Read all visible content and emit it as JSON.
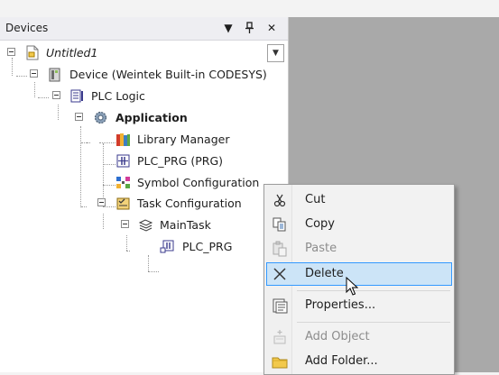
{
  "panel": {
    "title": "Devices",
    "dropdown_glyph": "▼",
    "pin_glyph": "⩚",
    "close_glyph": "✕",
    "combo_glyph": "▼"
  },
  "tree": {
    "project": "Untitled1",
    "device": "Device (Weintek Built-in CODESYS)",
    "plc_logic": "PLC Logic",
    "application": "Application",
    "library_manager": "Library Manager",
    "plc_prg": "PLC_PRG (PRG)",
    "symbol_config": "Symbol Configuration",
    "task_config": "Task Configuration",
    "main_task": "MainTask",
    "task_plc_prg": "PLC_PRG"
  },
  "context_menu": {
    "cut": "Cut",
    "copy": "Copy",
    "paste": "Paste",
    "delete": "Delete",
    "properties": "Properties...",
    "add_object": "Add Object",
    "add_folder": "Add Folder..."
  },
  "colors": {
    "workspace": "#a9a9a9",
    "menu_highlight": "#cce4f7",
    "menu_highlight_border": "#3399ff"
  }
}
